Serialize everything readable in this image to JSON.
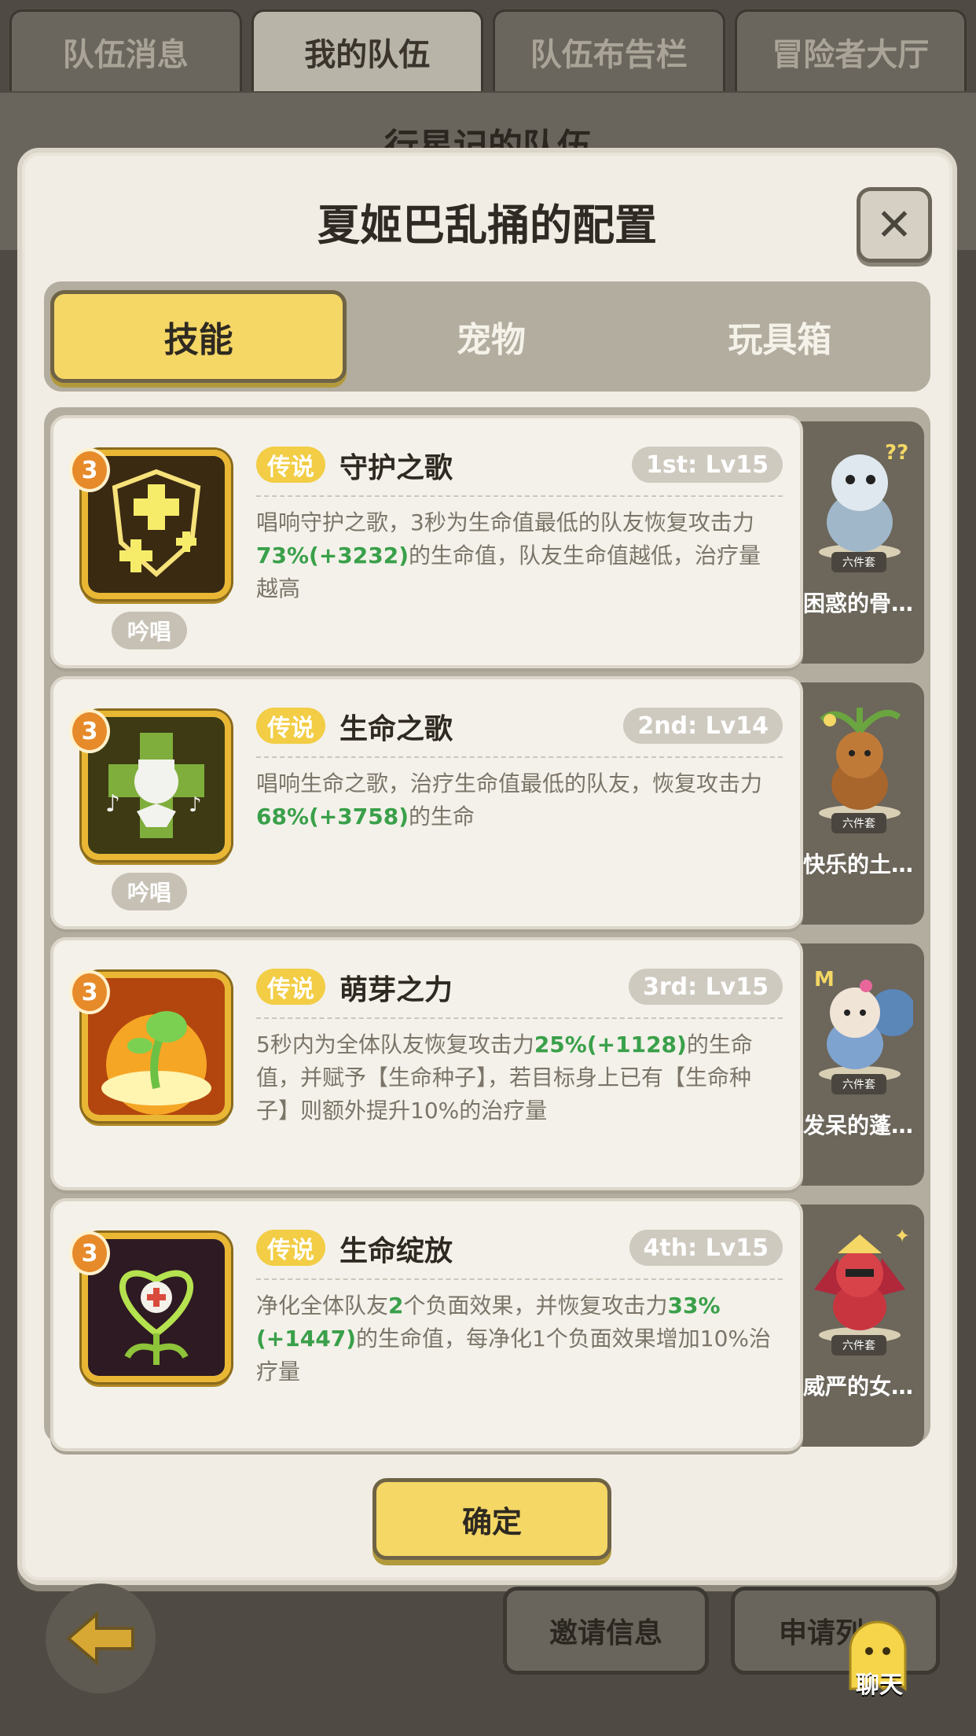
{
  "top_tabs": [
    {
      "label": "队伍消息"
    },
    {
      "label": "我的队伍"
    },
    {
      "label": "队伍布告栏"
    },
    {
      "label": "冒险者大厅"
    }
  ],
  "background_title": "行星记的队伍",
  "modal": {
    "title": "夏姬巴乱捅的配置",
    "close_icon": "close-icon",
    "tabs": [
      {
        "label": "技能"
      },
      {
        "label": "宠物"
      },
      {
        "label": "玩具箱"
      }
    ],
    "skills": [
      {
        "level_badge": "3",
        "rarity": "传说",
        "name": "守护之歌",
        "slot": "1st: Lv15",
        "cast_type": "吟唱",
        "desc_parts": [
          "唱响守护之歌，3秒为生命值最低的队友恢复攻击力",
          "73%(+3232)",
          "的生命值，队友生命值越低，治疗量越高"
        ],
        "pet_name": "困惑的骨…",
        "pet_set": "六件套"
      },
      {
        "level_badge": "3",
        "rarity": "传说",
        "name": "生命之歌",
        "slot": "2nd: Lv14",
        "cast_type": "吟唱",
        "desc_parts": [
          "唱响生命之歌，治疗生命值最低的队友，恢复攻击力",
          "68%(+3758)",
          "的生命"
        ],
        "pet_name": "快乐的土…",
        "pet_set": "六件套"
      },
      {
        "level_badge": "3",
        "rarity": "传说",
        "name": "萌芽之力",
        "slot": "3rd: Lv15",
        "cast_type": "",
        "desc_parts": [
          "5秒内为全体队友恢复攻击力",
          "25%(+1128)",
          "的生命值，并赋予【生命种子】，若目标身上已有【生命种子】则额外提升10%的治疗量"
        ],
        "pet_name": "发呆的蓬…",
        "pet_set": "六件套"
      },
      {
        "level_badge": "3",
        "rarity": "传说",
        "name": "生命绽放",
        "slot": "4th: Lv15",
        "cast_type": "",
        "desc_parts": [
          "净化全体队友",
          "2",
          "个负面效果，并恢复攻击力",
          "33%(+1447)",
          "的生命值，每净化1个负面效果增加10%治疗量"
        ],
        "pet_name": "威严的女…",
        "pet_set": "六件套"
      }
    ],
    "confirm_label": "确定"
  },
  "bottom": {
    "back_icon": "back-arrow-icon",
    "invite_label": "邀请信息",
    "apply_label": "申请列",
    "chat_label": "聊天"
  },
  "colors": {
    "accent_yellow": "#f4d765",
    "rarity_gold": "#f2cd45",
    "highlight_green": "#3aa04a",
    "panel_bg": "#f1ede5"
  }
}
